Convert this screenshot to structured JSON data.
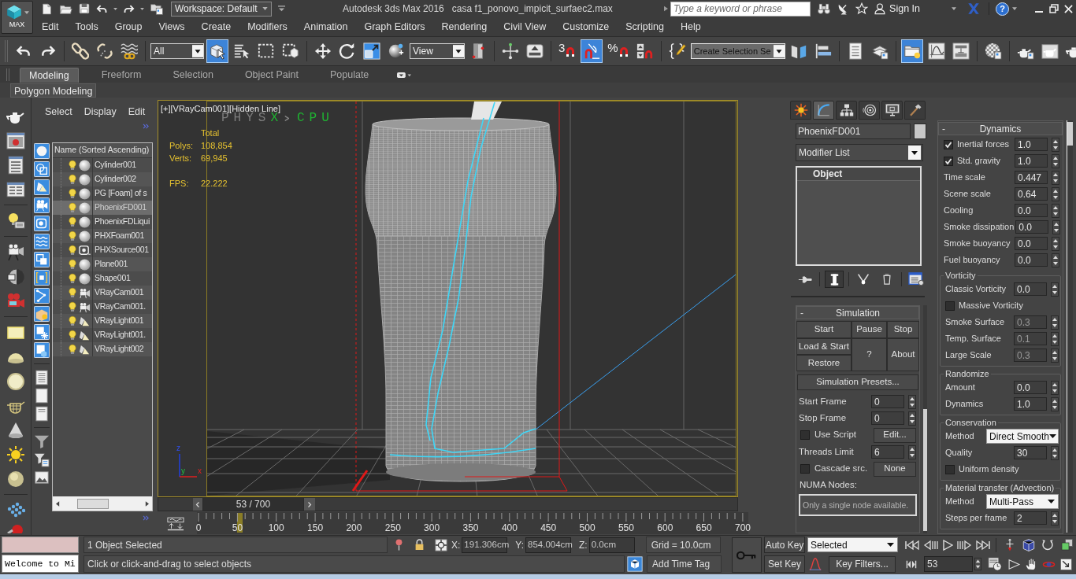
{
  "title_bar": {
    "logo": "MAX",
    "workspace": "Workspace: Default",
    "app_name": "Autodesk 3ds Max 2016",
    "file_name": "casa f1_ponovo_impicit_surfaec2.max",
    "search": {
      "placeholder": "Type a keyword or phrase"
    },
    "sign_in": "Sign In",
    "help": "?"
  },
  "menu_bar": [
    "Edit",
    "Tools",
    "Group",
    "Views",
    "Create",
    "Modifiers",
    "Animation",
    "Graph Editors",
    "Rendering",
    "Civil View",
    "Customize",
    "Scripting",
    "Help"
  ],
  "main_toolbar": {
    "selection_filter": "All",
    "select_object": {
      "selected": true
    },
    "reference_coordinate_system": "View",
    "snaps_toggle": {
      "label": "3",
      "selected": false
    },
    "angle_snap": {
      "selected": true
    },
    "percent_snap": {
      "label": "%",
      "selected": false
    },
    "named_selection_set": "Create Selection Se",
    "explorer_toggle": {
      "selected": true
    }
  },
  "ribbon": {
    "tabs": [
      {
        "label": "Modeling",
        "selected": true
      },
      {
        "label": "Freeform",
        "selected": false
      },
      {
        "label": "Selection",
        "selected": false
      },
      {
        "label": "Object Paint",
        "selected": false
      },
      {
        "label": "Populate",
        "selected": false
      }
    ],
    "panel_button": "Polygon Modeling"
  },
  "scene_explorer": {
    "menu": [
      "Select",
      "Display",
      "Edit"
    ],
    "column_header": "Name (Sorted Ascending)",
    "rows": [
      {
        "name": "Cylinder001",
        "kind": "geometry",
        "selected": false
      },
      {
        "name": "Cylinder002",
        "kind": "geometry",
        "selected": false
      },
      {
        "name": "PG [Foam] of s",
        "kind": "geometry",
        "selected": false
      },
      {
        "name": "PhoenixFD001",
        "kind": "geometry",
        "selected": true
      },
      {
        "name": "PhoenixFDLiqui",
        "kind": "geometry",
        "selected": false
      },
      {
        "name": "PHXFoam001",
        "kind": "geometry",
        "selected": false
      },
      {
        "name": "PHXSource001",
        "kind": "helper",
        "selected": false
      },
      {
        "name": "Plane001",
        "kind": "geometry",
        "selected": false
      },
      {
        "name": "Shape001",
        "kind": "geometry",
        "selected": false
      },
      {
        "name": "VRayCam001",
        "kind": "camera",
        "selected": false
      },
      {
        "name": "VRayCam001.",
        "kind": "camera",
        "selected": false
      },
      {
        "name": "VRayLight001",
        "kind": "light",
        "selected": false
      },
      {
        "name": "VRayLight001.",
        "kind": "light",
        "selected": false
      },
      {
        "name": "VRayLight002",
        "kind": "light",
        "selected": false
      }
    ]
  },
  "viewport": {
    "label": "[+][VRayCam001][Hidden Line]",
    "physx": {
      "prefix": "PHYS",
      "accent": "X",
      "mode": "CPU"
    },
    "stats": {
      "header": "Total",
      "rows": [
        {
          "label": "Polys:",
          "value": "108,854"
        },
        {
          "label": "Verts:",
          "value": "69,945"
        }
      ],
      "fps": {
        "label": "FPS:",
        "value": "22.222"
      }
    },
    "axes": {
      "x": "x",
      "y": "y",
      "z": "z"
    }
  },
  "time_slider": {
    "label": "53 / 700",
    "level": 0.0757
  },
  "track_bar": {
    "ticks": [
      "0",
      "50",
      "100",
      "150",
      "200",
      "250",
      "300",
      "350",
      "400",
      "450",
      "500",
      "550",
      "600",
      "650",
      "700"
    ],
    "level": 0.0757
  },
  "command_panel": {
    "tabs": [
      {
        "selected": false
      },
      {
        "selected": true
      },
      {
        "selected": false
      },
      {
        "selected": false
      },
      {
        "selected": false
      },
      {
        "selected": false
      }
    ],
    "object_name": "PhoenixFD001",
    "modifier_list": "Modifier List",
    "stack": [
      "Object"
    ],
    "stack_tools": [
      {
        "selected": false
      },
      {
        "selected": true
      },
      {
        "selected": false
      },
      {
        "selected": false
      },
      {
        "selected": false
      }
    ],
    "simulation": {
      "toggle": "-",
      "title": "Simulation",
      "buttons": {
        "start": "Start",
        "pause": "Pause",
        "stop": "Stop",
        "load_start": "Load & Start",
        "help": "?",
        "about": "About",
        "restore": "Restore",
        "presets": "Simulation Presets..."
      },
      "start_frame": {
        "label": "Start Frame",
        "value": "0"
      },
      "stop_frame": {
        "label": "Stop Frame",
        "value": "0"
      },
      "use_script": {
        "label": "Use Script",
        "checked": false,
        "button": "Edit..."
      },
      "threads_limit": {
        "label": "Threads Limit",
        "value": "6"
      },
      "cascade": {
        "label": "Cascade src.",
        "checked": false,
        "button": "None"
      },
      "numa": {
        "label": "NUMA Nodes:",
        "placeholder": "Only a single node available."
      }
    },
    "dynamics": {
      "toggle": "-",
      "title": "Dynamics",
      "rows": [
        {
          "kind": "checkbox_spinner",
          "label": "Inertial forces",
          "checked": true,
          "value": "1.0"
        },
        {
          "kind": "checkbox_spinner",
          "label": "Std. gravity",
          "checked": true,
          "value": "1.0"
        },
        {
          "kind": "spinner",
          "label": "Time scale",
          "value": "0.447"
        },
        {
          "kind": "spinner",
          "label": "Scene scale",
          "value": "0.64"
        },
        {
          "kind": "spinner",
          "label": "Cooling",
          "value": "0.0"
        },
        {
          "kind": "spinner",
          "label": "Smoke dissipation",
          "value": "0.0"
        },
        {
          "kind": "spinner",
          "label": "Smoke buoyancy",
          "value": "0.0"
        },
        {
          "kind": "spinner",
          "label": "Fuel buoyancy",
          "value": "0.0"
        }
      ],
      "groups": [
        {
          "title": "Vorticity",
          "rows": [
            {
              "kind": "spinner",
              "label": "Classic Vorticity",
              "value": "0.0",
              "disabled": false
            },
            {
              "kind": "checkbox",
              "label": "Massive Vorticity",
              "checked": false,
              "disabled": false
            },
            {
              "kind": "spinner",
              "label": "Smoke Surface",
              "value": "0.3",
              "disabled": true
            },
            {
              "kind": "spinner",
              "label": "Temp. Surface",
              "value": "0.1",
              "disabled": true
            },
            {
              "kind": "spinner",
              "label": "Large Scale",
              "value": "0.3",
              "disabled": true
            }
          ]
        },
        {
          "title": "Randomize",
          "rows": [
            {
              "kind": "spinner",
              "label": "Amount",
              "value": "0.0"
            },
            {
              "kind": "spinner",
              "label": "Dynamics",
              "value": "1.0"
            }
          ]
        },
        {
          "title": "Conservation",
          "rows": [
            {
              "kind": "dropdown",
              "label": "Method",
              "value": "Direct Smooth"
            },
            {
              "kind": "spinner",
              "label": "Quality",
              "value": "30"
            },
            {
              "kind": "checkbox",
              "label": "Uniform density",
              "checked": false
            }
          ]
        },
        {
          "title": "Material transfer (Advection)",
          "rows": [
            {
              "kind": "dropdown",
              "label": "Method",
              "value": "Multi-Pass"
            },
            {
              "kind": "spinner",
              "label": "Steps per frame",
              "value": "2"
            }
          ]
        }
      ]
    }
  },
  "status_bar": {
    "listener": "Welcome to Mi",
    "selection": "1 Object Selected",
    "prompt": "Click or click-and-drag to select objects",
    "coordinates": [
      {
        "label": "X:",
        "value": "191.306cm"
      },
      {
        "label": "Y:",
        "value": "854.004cm"
      },
      {
        "label": "Z:",
        "value": "0.0cm"
      }
    ],
    "grid": "Grid = 10.0cm",
    "time_tag": "Add Time Tag",
    "auto_key": "Auto Key",
    "set_key": "Set Key",
    "key_mode": "Selected",
    "key_filters": "Key Filters...",
    "current_frame": "53"
  }
}
